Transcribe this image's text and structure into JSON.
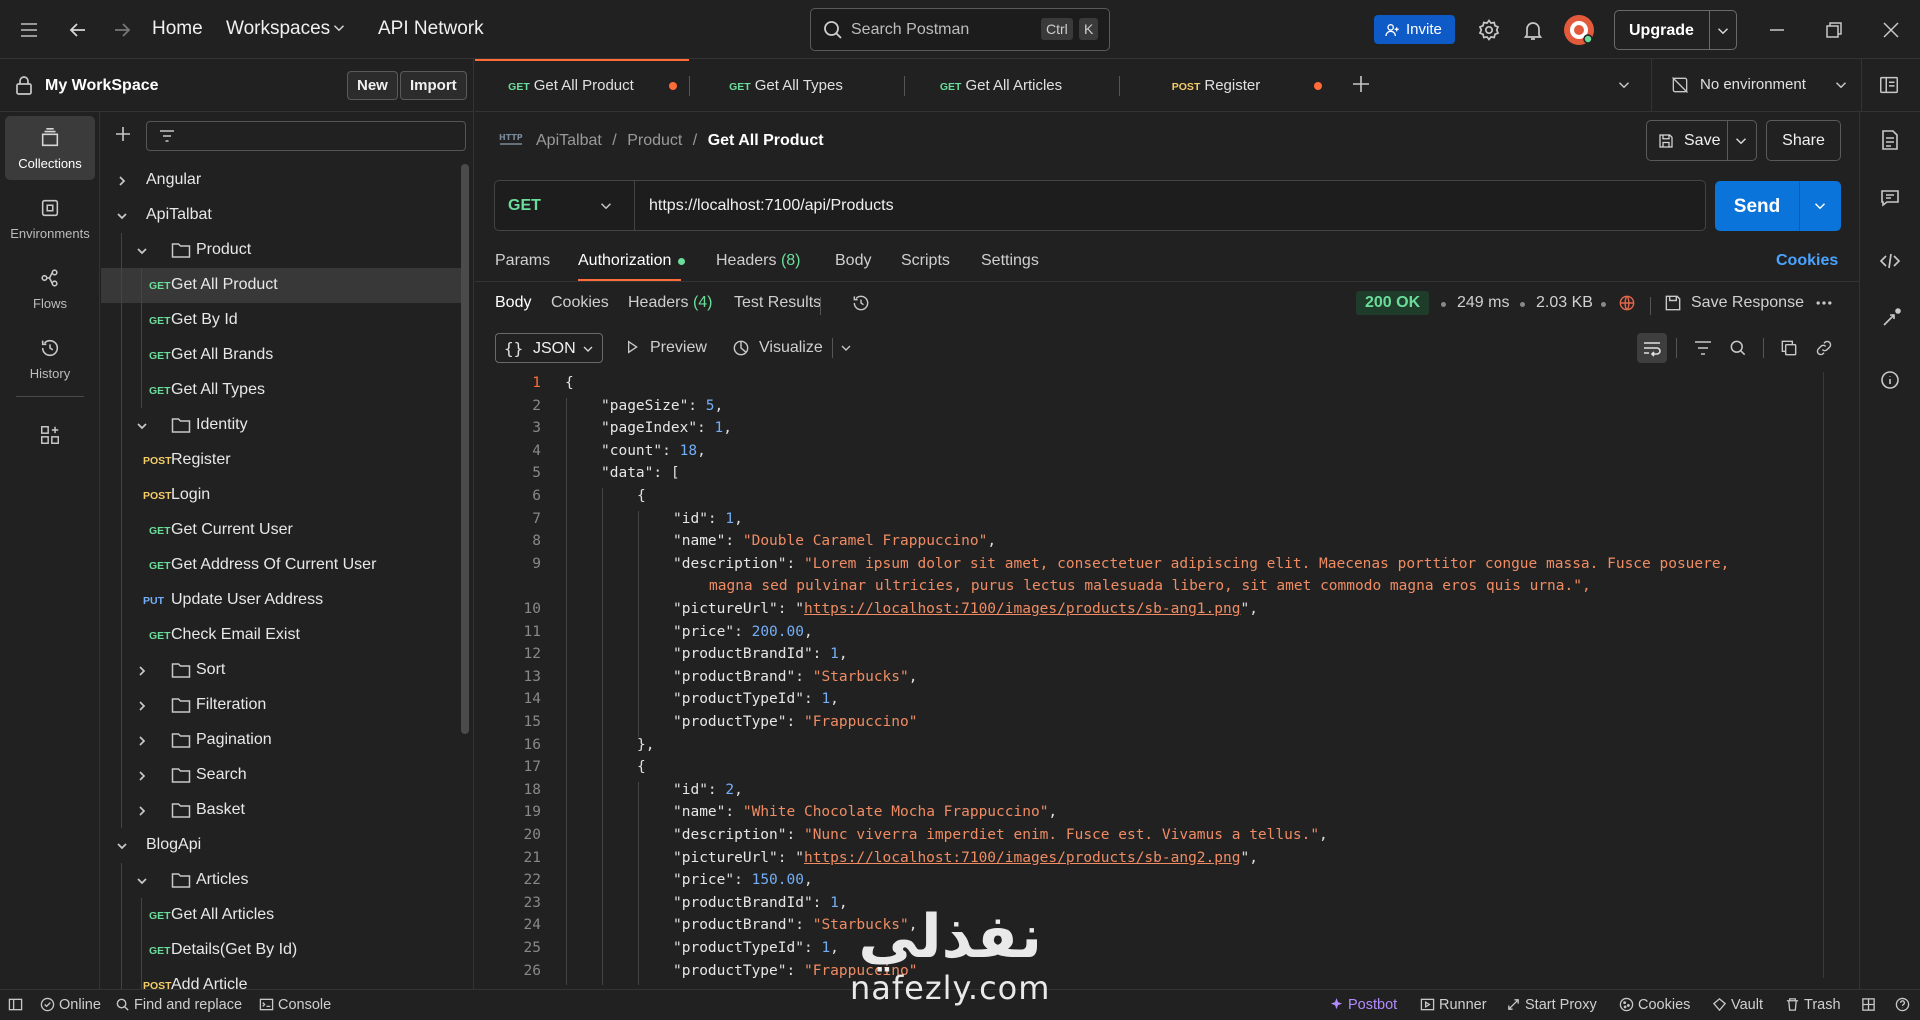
{
  "topbar": {
    "home": "Home",
    "workspaces": "Workspaces",
    "api_network": "API Network",
    "search_placeholder": "Search Postman",
    "kbd_ctrl": "Ctrl",
    "kbd_k": "K",
    "invite": "Invite",
    "upgrade": "Upgrade"
  },
  "workspace": {
    "name": "My WorkSpace",
    "new_label": "New",
    "import_label": "Import"
  },
  "rail": [
    {
      "label": "Collections",
      "icon": "collections-icon",
      "active": true
    },
    {
      "label": "Environments",
      "icon": "environments-icon",
      "active": false
    },
    {
      "label": "Flows",
      "icon": "flows-icon",
      "active": false
    },
    {
      "label": "History",
      "icon": "history-icon",
      "active": false
    }
  ],
  "tree": [
    {
      "label": "Angular",
      "type": "collection",
      "open": false,
      "level": 0
    },
    {
      "label": "ApiTalbat",
      "type": "collection",
      "open": true,
      "level": 0
    },
    {
      "label": "Product",
      "type": "folder",
      "open": true,
      "level": 1
    },
    {
      "label": "Get All Product",
      "type": "request",
      "method": "GET",
      "level": 2,
      "selected": true
    },
    {
      "label": "Get By Id",
      "type": "request",
      "method": "GET",
      "level": 2
    },
    {
      "label": "Get All Brands",
      "type": "request",
      "method": "GET",
      "level": 2
    },
    {
      "label": "Get All Types",
      "type": "request",
      "method": "GET",
      "level": 2
    },
    {
      "label": "Identity",
      "type": "folder",
      "open": true,
      "level": 1
    },
    {
      "label": "Register",
      "type": "request",
      "method": "POST",
      "level": 2
    },
    {
      "label": "Login",
      "type": "request",
      "method": "POST",
      "level": 2
    },
    {
      "label": "Get Current User",
      "type": "request",
      "method": "GET",
      "level": 2
    },
    {
      "label": "Get Address Of Current User",
      "type": "request",
      "method": "GET",
      "level": 2
    },
    {
      "label": "Update User Address",
      "type": "request",
      "method": "PUT",
      "level": 2
    },
    {
      "label": "Check Email Exist",
      "type": "request",
      "method": "GET",
      "level": 2
    },
    {
      "label": "Sort",
      "type": "folder",
      "open": false,
      "level": 1
    },
    {
      "label": "Filteration",
      "type": "folder",
      "open": false,
      "level": 1
    },
    {
      "label": "Pagination",
      "type": "folder",
      "open": false,
      "level": 1
    },
    {
      "label": "Search",
      "type": "folder",
      "open": false,
      "level": 1
    },
    {
      "label": "Basket",
      "type": "folder",
      "open": false,
      "level": 1
    },
    {
      "label": "BlogApi",
      "type": "collection",
      "open": true,
      "level": 0
    },
    {
      "label": "Articles",
      "type": "folder",
      "open": true,
      "level": 1
    },
    {
      "label": "Get All Articles",
      "type": "request",
      "method": "GET",
      "level": 2
    },
    {
      "label": "Details(Get By Id)",
      "type": "request",
      "method": "GET",
      "level": 2
    },
    {
      "label": "Add Article",
      "type": "request",
      "method": "POST",
      "level": 2
    }
  ],
  "tabs": [
    {
      "method": "GET",
      "label": "Get All Product",
      "active": true,
      "unsaved": true
    },
    {
      "method": "GET",
      "label": "Get All Types",
      "active": false,
      "unsaved": false
    },
    {
      "method": "GET",
      "label": "Get All Articles",
      "active": false,
      "unsaved": false
    },
    {
      "method": "POST",
      "label": "Register",
      "active": false,
      "unsaved": true
    }
  ],
  "environment": "No environment",
  "breadcrumb": {
    "root": "ApiTalbat",
    "folder": "Product",
    "current": "Get All Product",
    "sep": "/"
  },
  "request": {
    "save": "Save",
    "share": "Share",
    "method": "GET",
    "url": "https://localhost:7100/api/Products",
    "send": "Send"
  },
  "request_tabs": {
    "params": "Params",
    "authorization": "Authorization",
    "headers": "Headers",
    "headers_count": "(8)",
    "body": "Body",
    "scripts": "Scripts",
    "settings": "Settings",
    "cookies": "Cookies"
  },
  "response_tabs": {
    "body": "Body",
    "cookies": "Cookies",
    "headers": "Headers",
    "headers_count": "(4)",
    "test_results": "Test Results"
  },
  "response_meta": {
    "status": "200 OK",
    "time": "249 ms",
    "size": "2.03 KB",
    "save_response": "Save Response"
  },
  "response_toolbar": {
    "format": "JSON",
    "preview": "Preview",
    "visualize": "Visualize"
  },
  "code_lines": [
    {
      "no": "1",
      "indent": 0,
      "html": "{"
    },
    {
      "no": "2",
      "indent": 1,
      "key": "pageSize",
      "num": "5"
    },
    {
      "no": "3",
      "indent": 1,
      "key": "pageIndex",
      "num": "1"
    },
    {
      "no": "4",
      "indent": 1,
      "key": "count",
      "num": "18"
    },
    {
      "no": "5",
      "indent": 1,
      "key": "data",
      "open": "["
    },
    {
      "no": "6",
      "indent": 2,
      "html": "{"
    },
    {
      "no": "7",
      "indent": 3,
      "key": "id",
      "num": "1"
    },
    {
      "no": "8",
      "indent": 3,
      "key": "name",
      "str": "Double Caramel Frappuccino"
    },
    {
      "no": "9",
      "indent": 3,
      "key": "description",
      "str": "Lorem ipsum dolor sit amet, consectetuer adipiscing elit. Maecenas porttitor congue massa. Fusce posuere,",
      "wrap": "magna sed pulvinar ultricies, purus lectus malesuada libero, sit amet commodo magna eros quis urna.\","
    },
    {
      "no": "10",
      "indent": 3,
      "key": "pictureUrl",
      "url": "https://localhost:7100/images/products/sb-ang1.png"
    },
    {
      "no": "11",
      "indent": 3,
      "key": "price",
      "num": "200.00"
    },
    {
      "no": "12",
      "indent": 3,
      "key": "productBrandId",
      "num": "1"
    },
    {
      "no": "13",
      "indent": 3,
      "key": "productBrand",
      "str": "Starbucks"
    },
    {
      "no": "14",
      "indent": 3,
      "key": "productTypeId",
      "num": "1"
    },
    {
      "no": "15",
      "indent": 3,
      "key": "productType",
      "str": "Frappuccino",
      "last": true
    },
    {
      "no": "16",
      "indent": 2,
      "html": "},"
    },
    {
      "no": "17",
      "indent": 2,
      "html": "{"
    },
    {
      "no": "18",
      "indent": 3,
      "key": "id",
      "num": "2"
    },
    {
      "no": "19",
      "indent": 3,
      "key": "name",
      "str": "White Chocolate Mocha Frappuccino"
    },
    {
      "no": "20",
      "indent": 3,
      "key": "description",
      "str": "Nunc viverra imperdiet enim. Fusce est. Vivamus a tellus."
    },
    {
      "no": "21",
      "indent": 3,
      "key": "pictureUrl",
      "url": "https://localhost:7100/images/products/sb-ang2.png"
    },
    {
      "no": "22",
      "indent": 3,
      "key": "price",
      "num": "150.00"
    },
    {
      "no": "23",
      "indent": 3,
      "key": "productBrandId",
      "num": "1"
    },
    {
      "no": "24",
      "indent": 3,
      "key": "productBrand",
      "str": "Starbucks"
    },
    {
      "no": "25",
      "indent": 3,
      "key": "productTypeId",
      "num": "1"
    },
    {
      "no": "26",
      "indent": 3,
      "key": "productType",
      "str": "Frappuccino",
      "last": true
    }
  ],
  "statusbar": {
    "online": "Online",
    "find_replace": "Find and replace",
    "console": "Console",
    "postbot": "Postbot",
    "runner": "Runner",
    "start_proxy": "Start Proxy",
    "cookies": "Cookies",
    "vault": "Vault",
    "trash": "Trash"
  },
  "watermark": {
    "arabic": "نفذلي",
    "latin": "nafezly.com"
  },
  "colors": {
    "accent": "#ff6c37",
    "send": "#0a74da",
    "get": "#6bdd9a",
    "post": "#f5cd68",
    "put": "#74aef6"
  }
}
